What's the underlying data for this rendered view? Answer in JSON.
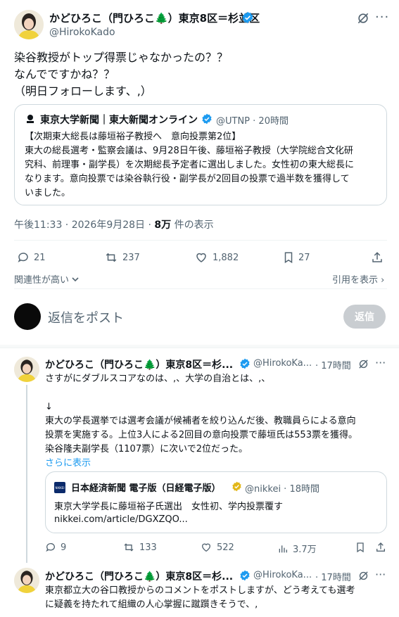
{
  "main_tweet": {
    "author_name": "かどひろこ（門ひろこ🌲）東京8区＝杉並区",
    "author_handle": "@HirokoKado",
    "text_lines": [
      "染谷教授がトップ得票じゃなかったの？？",
      "なんでですかね？？",
      "（明日フォローします、,）"
    ],
    "quote": {
      "source_name": "東京大学新聞｜東大新聞オンライン",
      "source_handle": "@UTNP · 20時間",
      "headline": "【次期東大総長は藤垣裕子教授へ　意向投票第2位】",
      "text_lines": [
        "東大の総長選考・監察会議は、9月28日午後、藤垣裕子教授（大学院総合文化研",
        "究科、前理事・副学長）を次期総長予定者に選出しました。女性初の東大総長に",
        "なります。意向投票では染谷執行役・副学長が2回目の投票で過半数を獲得して",
        "いました。"
      ]
    },
    "timestamp": "午後11:33 · 2026年9月28日 ·",
    "views_count": "8万",
    "views_label": "件の表示",
    "stats": {
      "replies": "21",
      "retweets": "237",
      "likes": "1,882",
      "bookmarks": "27"
    },
    "sort_label": "関連性が高い",
    "quotes_label": "引用を表示"
  },
  "reply_composer": {
    "placeholder": "返信をポスト",
    "button_label": "返信"
  },
  "reply1": {
    "author_name": "かどひろこ（門ひろこ🌲）東京8区＝杉...",
    "author_handle": "@HirokoKa...",
    "time": "· 17時間",
    "text_line1": "さすがにダブルスコアなのは、,、大学の自治とは、,、",
    "arrow": "↓",
    "text_lines": [
      "東大の学長選挙では選考会議が候補者を絞り込んだ後、教職員らによる意向",
      "投票を実施する。上位3人による2回目の意向投票で藤垣氏は553票を獲得。",
      "染谷隆夫副学長（1107票）に次いで2位だった。"
    ],
    "show_more": "さらに表示",
    "card": {
      "source_name": "日本経済新聞 電子版（日経電子版）",
      "source_handle": "@nikkei · 18時間",
      "logo_text": "NIKKEI",
      "title": "東京大学学長に藤垣裕子氏選出　女性初、学内投票覆す",
      "url": "nikkei.com/article/DGXZQO..."
    },
    "stats": {
      "replies": "9",
      "retweets": "133",
      "likes": "522",
      "views": "3.7万"
    }
  },
  "reply2": {
    "author_name": "かどひろこ（門ひろこ🌲）東京8区＝杉...",
    "author_handle": "@HirokoKa...",
    "time": "· 17時間",
    "text_lines": [
      "東京都立大の谷口教授からのコメントをポストしますが、どう考えても選考",
      "に疑義を持たれて組織の人心掌握に蹴躓きそうで、,"
    ]
  },
  "colors": {
    "accent": "#1d9bf0",
    "verified": "#1d9bf0",
    "gold_verified": "#e2b719",
    "muted": "#536471"
  }
}
